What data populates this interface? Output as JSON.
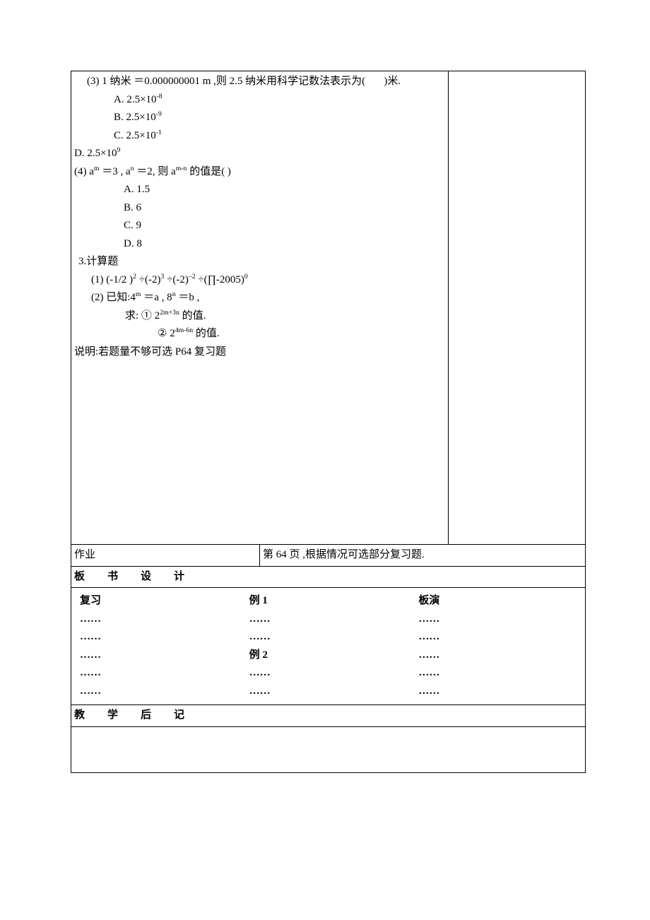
{
  "q3": {
    "stem_a": "(3) 1 纳米 ＝0.000000001 m ,则 2.5 纳米用科学记数法表示为(",
    "stem_b": ")米.",
    "A": "A. 2.5×10",
    "A_exp": "-8",
    "B": "B. 2.5×10",
    "B_exp": "-9",
    "C": "C. 2.5×10",
    "C_exp": "-1",
    "D": "D. 2.5×10",
    "D_exp": "9"
  },
  "q4": {
    "stem_a": "(4) a",
    "exp_m": "m",
    "mid1": " ＝3 ,   a",
    "exp_n": "n",
    "mid2": " ＝2,  则 a",
    "exp_mn": "m-n",
    "stem_b": "  的值是(       )",
    "A": "A. 1.5",
    "B": "B. 6",
    "C": "C. 9",
    "D": "D. 8"
  },
  "calc": {
    "title": "3.计算题",
    "line1_a": "(1) (-1/2 )",
    "e1": "2",
    "line1_b": " ÷(-2)",
    "e2": "3",
    "line1_c": "   ÷(-2)",
    "e3": "–2",
    "line1_d": " ÷(∏-2005)",
    "e4": "0",
    "line2_a": "(2)  已知:4",
    "e5": "m",
    "line2_b": " ＝a ,   8",
    "e6": "n",
    "line2_c": " ＝b ,",
    "line3_a": "求:  ①    2",
    "e7": "2m+3n",
    "line3_b": "  的值.",
    "line4_a": "②    2",
    "e8": "4m-6n",
    "line4_b": "  的值."
  },
  "note": "说明:若题量不够可选 P64  复习题",
  "hw": {
    "label": "作业",
    "text": "第 64 页 ,根据情况可选部分复习题."
  },
  "board": {
    "header": "板书设计",
    "col1": [
      "复习",
      "……",
      "……",
      "……",
      "……",
      "……"
    ],
    "col2": [
      "例 1",
      "……",
      "……",
      "例 2",
      "……",
      "……"
    ],
    "col3": [
      "板演",
      "……",
      "……",
      "……",
      "……",
      "……"
    ]
  },
  "afternote": {
    "header": "教学后记"
  }
}
